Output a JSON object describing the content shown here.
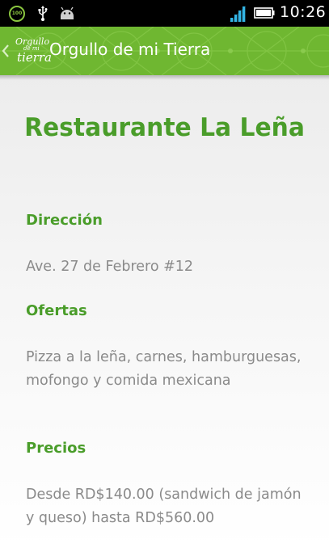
{
  "status_bar": {
    "battery_badge": "100",
    "time": "10:26",
    "icons": [
      "battery-100-icon",
      "usb-icon",
      "android-icon",
      "signal-icon",
      "battery-icon"
    ],
    "colors": {
      "background": "#000000",
      "accent": "#8ac53f",
      "signal": "#33b5e5"
    }
  },
  "action_bar": {
    "logo_text_line1": "Orgullo",
    "logo_text_line2": "de mi",
    "logo_text_line3": "tierra",
    "title": "Orgullo de mi Tierra",
    "colors": {
      "background": "#6fb731"
    }
  },
  "restaurant": {
    "name": "Restaurante La Leña",
    "sections": [
      {
        "heading": "Dirección",
        "text": "Ave. 27 de Febrero #12"
      },
      {
        "heading": "Ofertas",
        "text": "Pizza a la leña, carnes, hamburguesas, mofongo y comida mexicana"
      },
      {
        "heading": "Precios",
        "text": "Desde RD$140.00 (sandwich de jamón y queso) hasta RD$560.00"
      }
    ],
    "colors": {
      "heading": "#4a9d2a",
      "body_text": "#8a8a8a"
    }
  }
}
